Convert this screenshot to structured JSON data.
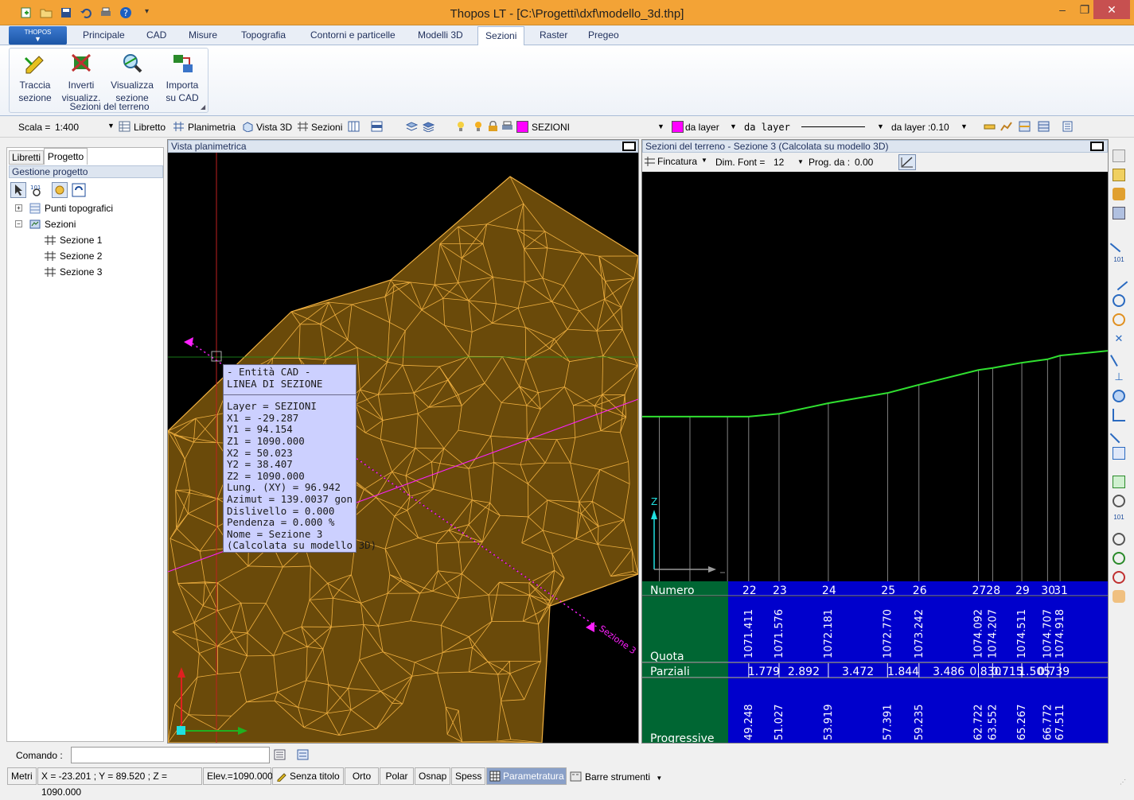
{
  "window": {
    "title": "Thopos LT - [C:\\Progetti\\dxf\\modello_3d.thp]",
    "min_label": "‒",
    "max_label": "❐",
    "close_label": "✕"
  },
  "ribbon": {
    "app_button": "THOPOS",
    "tabs": [
      "Principale",
      "CAD",
      "Misure",
      "Topografia",
      "Contorni e particelle",
      "Modelli 3D",
      "Sezioni",
      "Raster",
      "Pregeo"
    ],
    "active_tab": "Sezioni",
    "group_label": "Sezioni del terreno",
    "buttons": [
      {
        "line1": "Traccia",
        "line2": "sezione"
      },
      {
        "line1": "Inverti",
        "line2": "visualizz."
      },
      {
        "line1": "Visualizza",
        "line2": "sezione"
      },
      {
        "line1": "Importa",
        "line2": "su CAD"
      }
    ]
  },
  "toolbar": {
    "scala_label": "Scala =",
    "scala_value": "1:400",
    "libretto": "Libretto",
    "planimetria": "Planimetria",
    "vista3d": "Vista 3D",
    "sezioni": "Sezioni",
    "layer_name": "SEZIONI",
    "color_label": "da layer",
    "linetype_label": "da layer",
    "lineweight_label": "da layer :0.10",
    "layer_color": "#ff00ff"
  },
  "left_panel": {
    "tabs": [
      "Libretti",
      "Progetto"
    ],
    "active_tab": "Progetto",
    "header": "Gestione progetto",
    "tree": {
      "punti": "Punti topografici",
      "sezioni": "Sezioni",
      "children": [
        "Sezione 1",
        "Sezione 2",
        "Sezione 3"
      ]
    }
  },
  "plan_view": {
    "title": "Vista planimetrica",
    "section_label": "Sezione 3",
    "tooltip": [
      "- Entità CAD -",
      "LINEA DI SEZIONE",
      "Layer = SEZIONI",
      "X1 = -29.287",
      "Y1 = 94.154",
      "Z1 = 1090.000",
      "X2 = 50.023",
      "Y2 = 38.407",
      "Z2 = 1090.000",
      "Lung. (XY) = 96.942",
      "Azimut = 139.0037 gon",
      "Dislivello = 0.000",
      "Pendenza = 0.000 %",
      "Nome = Sezione 3",
      "(Calcolata su modello 3D)"
    ]
  },
  "section_view": {
    "title": "Sezioni del terreno - Sezione 3 (Calcolata su modello 3D)",
    "fincatura": "Fincatura",
    "dim_font_label": "Dim. Font =",
    "dim_font_value": "12",
    "prog_label": "Prog. da :",
    "prog_value": "0.00",
    "z_label": "Z",
    "row_labels": {
      "numero": "Numero",
      "quota": "Quota",
      "parziali": "Parziali",
      "progressive": "Progressive"
    },
    "numbers": [
      "22",
      "23",
      "24",
      "25",
      "26",
      "27",
      "28",
      "29",
      "30",
      "31"
    ],
    "quote": [
      "1071.411",
      "1071.576",
      "1072.181",
      "1072.770",
      "1073.242",
      "1074.092",
      "1074.207",
      "1074.511",
      "1074.707",
      "1074.918"
    ],
    "parziali": [
      "1.779",
      "2.892",
      "3.472",
      "1.844",
      "3.486",
      "0.830",
      "0.715",
      "1.505",
      "0.739"
    ],
    "progressive": [
      "49.248",
      "51.027",
      "53.919",
      "57.391",
      "59.235",
      "62.722",
      "63.552",
      "65.267",
      "66.772",
      "67.511"
    ]
  },
  "command": {
    "label": "Comando :",
    "value": ""
  },
  "statusbar": {
    "units": "Metri",
    "coords": "X = -23.201 ; Y = 89.520 ; Z = 1090.000",
    "elev": "Elev.=1090.000",
    "style": "Senza titolo",
    "orto": "Orto",
    "polar": "Polar",
    "osnap": "Osnap",
    "spess": "Spess",
    "param": "Parametratura",
    "barre": "Barre strumenti"
  }
}
